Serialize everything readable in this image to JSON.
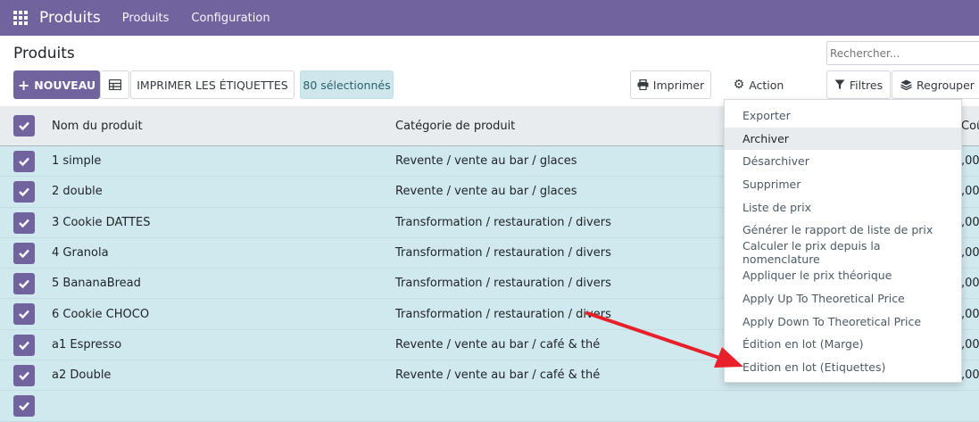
{
  "navbar": {
    "brand": "Produits",
    "links": [
      "Produits",
      "Configuration"
    ]
  },
  "control": {
    "title": "Produits",
    "search_placeholder": "Rechercher...",
    "new_label": "NOUVEAU",
    "print_labels": "IMPRIMER LES ÉTIQUETTES",
    "selected_label": "80 sélectionnés",
    "print_label": "Imprimer",
    "action_label": "Action",
    "filters_label": "Filtres",
    "groupby_label": "Regrouper p"
  },
  "table": {
    "headers": {
      "name": "Nom du produit",
      "category": "Catégorie de produit",
      "cost": "Coû"
    },
    "rows": [
      {
        "name": "1 simple",
        "category": "Revente / vente au bar / glaces",
        "cost": ",00"
      },
      {
        "name": "2 double",
        "category": "Revente / vente au bar / glaces",
        "cost": ",00"
      },
      {
        "name": "3 Cookie DATTES",
        "category": "Transformation / restauration / divers",
        "cost": ",00"
      },
      {
        "name": "4 Granola",
        "category": "Transformation / restauration / divers",
        "cost": ",00"
      },
      {
        "name": "5 BananaBread",
        "category": "Transformation / restauration / divers",
        "cost": ",00"
      },
      {
        "name": "6 Cookie CHOCO",
        "category": "Transformation / restauration / divers",
        "cost": ",00"
      },
      {
        "name": "a1 Espresso",
        "category": "Revente / vente au bar / café & thé",
        "cost": ",00"
      },
      {
        "name": "a2 Double",
        "category": "Revente / vente au bar / café & thé",
        "cost": ",00"
      }
    ]
  },
  "action_menu": {
    "items": [
      "Exporter",
      "Archiver",
      "Désarchiver",
      "Supprimer",
      "Liste de prix",
      "Générer le rapport de liste de prix",
      "Calculer le prix depuis la nomenclature",
      "Appliquer le prix théorique",
      "Apply Up To Theoretical Price",
      "Apply Down To Theoretical Price",
      "Édition en lot (Marge)",
      "Edition en lot (Etiquettes)"
    ],
    "hovered_index": 1
  },
  "colors": {
    "brand": "#71639e",
    "selected_row": "#d0e9ee",
    "arrow": "#e8202a"
  }
}
